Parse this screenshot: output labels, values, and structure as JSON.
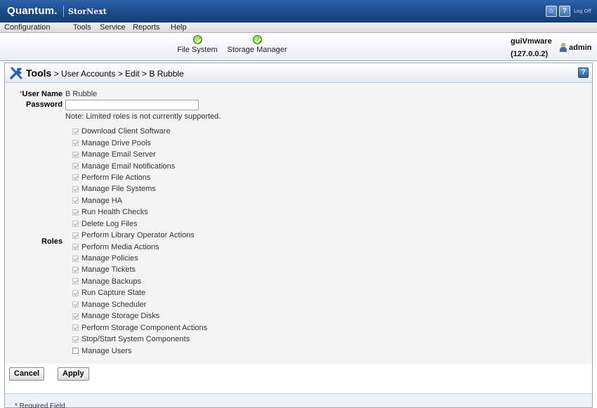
{
  "header": {
    "brand": "Quantum.",
    "product": "StorNext",
    "home_icon": "home-icon",
    "help_icon": "help-icon",
    "logoff_label": "Log Off"
  },
  "menu": [
    "Configuration",
    "Tools",
    "Service",
    "Reports",
    "Help"
  ],
  "status": {
    "items": [
      {
        "label": "File System",
        "icon": "check-circle-icon"
      },
      {
        "label": "Storage Manager",
        "icon": "check-circle-icon"
      }
    ],
    "server_name": "guiVmware",
    "server_ip": "(127.0.0.2)",
    "user": "admin"
  },
  "page": {
    "section": "Tools",
    "breadcrumb_rest": " > User Accounts > Edit > B Rubble"
  },
  "form": {
    "username_label": "User Name",
    "username_value": "B Rubble",
    "password_label": "Password",
    "password_value": "",
    "note": "Note: Limited roles is not currently supported.",
    "roles_label": "Roles",
    "roles": [
      {
        "label": "Download Client Software",
        "checked": true
      },
      {
        "label": "Manage Drive Pools",
        "checked": true
      },
      {
        "label": "Manage Email Server",
        "checked": true
      },
      {
        "label": "Manage Email Notifications",
        "checked": true
      },
      {
        "label": "Perform File Actions",
        "checked": true
      },
      {
        "label": "Manage File Systems",
        "checked": true
      },
      {
        "label": "Manage HA",
        "checked": true
      },
      {
        "label": "Run Health Checks",
        "checked": true
      },
      {
        "label": "Delete Log Files",
        "checked": true
      },
      {
        "label": "Perform Library Operator Actions",
        "checked": true
      },
      {
        "label": "Perform Media Actions",
        "checked": true
      },
      {
        "label": "Manage Policies",
        "checked": true
      },
      {
        "label": "Manage Tickets",
        "checked": true
      },
      {
        "label": "Manage Backups",
        "checked": true
      },
      {
        "label": "Run Capture State",
        "checked": true
      },
      {
        "label": "Manage Scheduler",
        "checked": true
      },
      {
        "label": "Manage Storage Disks",
        "checked": true
      },
      {
        "label": "Perform Storage Component Actions",
        "checked": true
      },
      {
        "label": "Stop/Start System Components",
        "checked": true
      },
      {
        "label": "Manage Users",
        "checked": false
      }
    ]
  },
  "buttons": {
    "cancel": "Cancel",
    "apply": "Apply"
  },
  "footer": {
    "required": "* Required Field"
  }
}
